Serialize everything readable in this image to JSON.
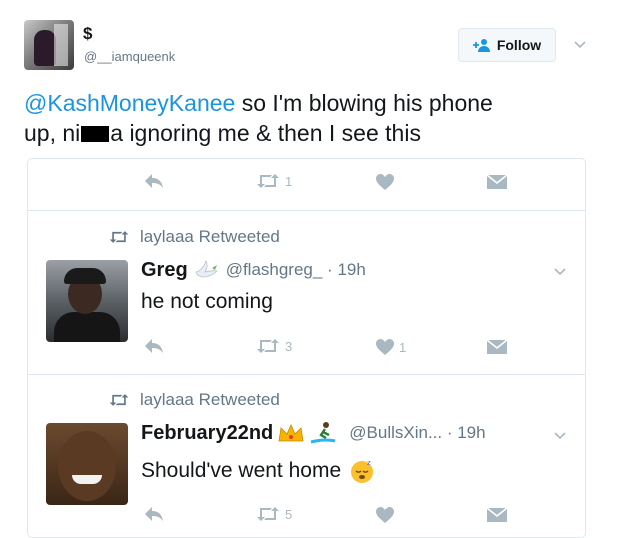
{
  "main_tweet": {
    "display_name": "$",
    "handle": "@__iamqueenk",
    "follow_label": "Follow",
    "text_mention": "@KashMoneyKanee",
    "text_part1": " so I'm blowing his phone",
    "text_part2a": "up, ni",
    "text_part2b": "a ignoring me & then I see this",
    "retweet_count": "1"
  },
  "retweets": [
    {
      "retweeted_by": "laylaaa Retweeted",
      "name": "Greg",
      "handle_time": "@flashgreg_ · 19h",
      "text": "he not coming",
      "retweet_count": "3",
      "like_count": "1"
    },
    {
      "retweeted_by": "laylaaa Retweeted",
      "name": "February22nd",
      "handle_time": "@BullsXin... · 19h",
      "text": "Should've went home",
      "retweet_count": "5"
    }
  ],
  "colors": {
    "link": "#1b95e0",
    "muted": "#657786",
    "icon": "#aab8c2",
    "border": "#e1e8ed"
  },
  "icons": [
    "reply-icon",
    "retweet-icon",
    "like-icon",
    "dm-icon",
    "chevron-down-icon",
    "follow-person-icon",
    "dove-emoji",
    "crown-emoji",
    "surfer-emoji",
    "sleeping-emoji"
  ]
}
